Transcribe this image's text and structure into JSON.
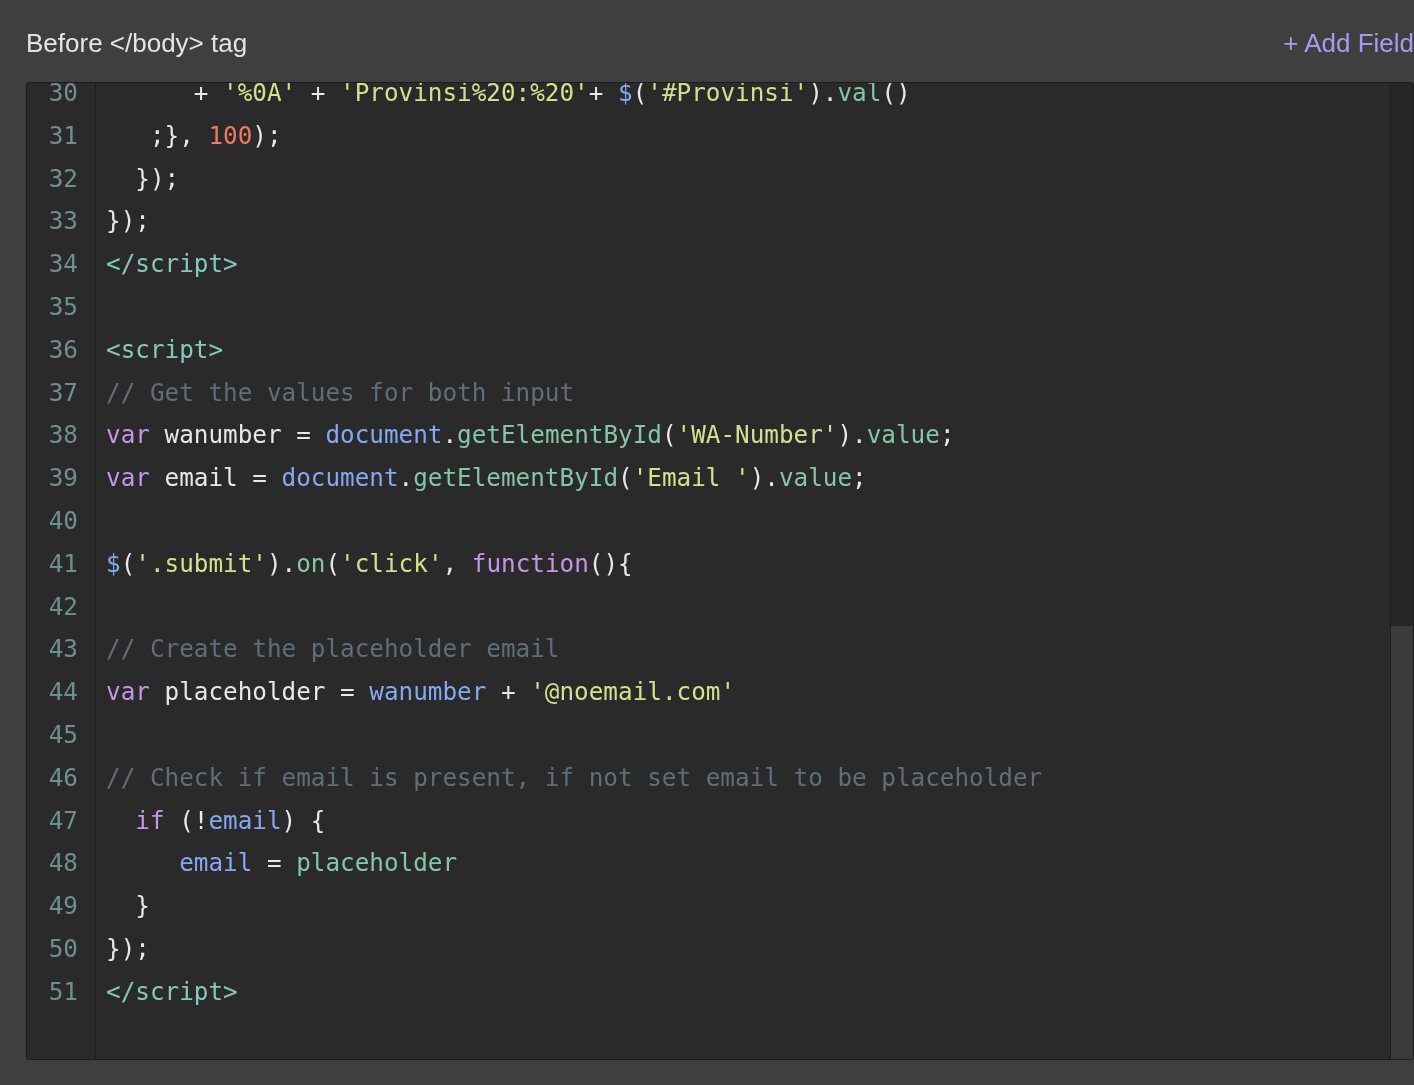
{
  "header": {
    "title": "Before </body> tag",
    "action": "+ Add Field"
  },
  "editor": {
    "lines": [
      {
        "number": "30",
        "tokens": [
          {
            "kind": "plain",
            "text": "      + "
          },
          {
            "kind": "string",
            "text": "'%0A'"
          },
          {
            "kind": "plain",
            "text": " + "
          },
          {
            "kind": "string",
            "text": "'Provinsi%20:%20'"
          },
          {
            "kind": "plain",
            "text": "+ "
          },
          {
            "kind": "variable",
            "text": "$"
          },
          {
            "kind": "plain",
            "text": "("
          },
          {
            "kind": "string",
            "text": "'#Provinsi'"
          },
          {
            "kind": "plain",
            "text": ")."
          },
          {
            "kind": "method",
            "text": "val"
          },
          {
            "kind": "plain",
            "text": "()"
          }
        ]
      },
      {
        "number": "31",
        "tokens": [
          {
            "kind": "plain",
            "text": "   ;}, "
          },
          {
            "kind": "number",
            "text": "100"
          },
          {
            "kind": "plain",
            "text": ");"
          }
        ]
      },
      {
        "number": "32",
        "tokens": [
          {
            "kind": "plain",
            "text": "  });"
          }
        ]
      },
      {
        "number": "33",
        "tokens": [
          {
            "kind": "plain",
            "text": "});"
          }
        ]
      },
      {
        "number": "34",
        "tokens": [
          {
            "kind": "tag",
            "text": "</script>"
          }
        ]
      },
      {
        "number": "35"
      },
      {
        "number": "36",
        "tokens": [
          {
            "kind": "tag",
            "text": "<script>"
          }
        ]
      },
      {
        "number": "37",
        "tokens": [
          {
            "kind": "comment",
            "text": "// Get the values for both input"
          }
        ]
      },
      {
        "number": "38",
        "tokens": [
          {
            "kind": "keyword",
            "text": "var"
          },
          {
            "kind": "plain",
            "text": " wanumber = "
          },
          {
            "kind": "variable",
            "text": "document"
          },
          {
            "kind": "plain",
            "text": "."
          },
          {
            "kind": "method",
            "text": "getElementById"
          },
          {
            "kind": "plain",
            "text": "("
          },
          {
            "kind": "string",
            "text": "'WA-Number'"
          },
          {
            "kind": "plain",
            "text": ")."
          },
          {
            "kind": "method",
            "text": "value"
          },
          {
            "kind": "plain",
            "text": ";"
          }
        ]
      },
      {
        "number": "39",
        "tokens": [
          {
            "kind": "keyword",
            "text": "var"
          },
          {
            "kind": "plain",
            "text": " email = "
          },
          {
            "kind": "variable",
            "text": "document"
          },
          {
            "kind": "plain",
            "text": "."
          },
          {
            "kind": "method",
            "text": "getElementById"
          },
          {
            "kind": "plain",
            "text": "("
          },
          {
            "kind": "string",
            "text": "'Email '"
          },
          {
            "kind": "plain",
            "text": ")."
          },
          {
            "kind": "method",
            "text": "value"
          },
          {
            "kind": "plain",
            "text": ";"
          }
        ]
      },
      {
        "number": "40"
      },
      {
        "number": "41",
        "tokens": [
          {
            "kind": "variable",
            "text": "$"
          },
          {
            "kind": "plain",
            "text": "("
          },
          {
            "kind": "string",
            "text": "'.submit'"
          },
          {
            "kind": "plain",
            "text": ")."
          },
          {
            "kind": "method",
            "text": "on"
          },
          {
            "kind": "plain",
            "text": "("
          },
          {
            "kind": "string",
            "text": "'click'"
          },
          {
            "kind": "plain",
            "text": ", "
          },
          {
            "kind": "keyword",
            "text": "function"
          },
          {
            "kind": "plain",
            "text": "(){"
          }
        ]
      },
      {
        "number": "42"
      },
      {
        "number": "43",
        "tokens": [
          {
            "kind": "comment",
            "text": "// Create the placeholder email"
          }
        ]
      },
      {
        "number": "44",
        "tokens": [
          {
            "kind": "keyword",
            "text": "var"
          },
          {
            "kind": "plain",
            "text": " placeholder = "
          },
          {
            "kind": "variable",
            "text": "wanumber"
          },
          {
            "kind": "plain",
            "text": " + "
          },
          {
            "kind": "string",
            "text": "'@noemail.com'"
          }
        ]
      },
      {
        "number": "45"
      },
      {
        "number": "46",
        "tokens": [
          {
            "kind": "comment",
            "text": "// Check if email is present, if not set email to be placeholder"
          }
        ]
      },
      {
        "number": "47",
        "tokens": [
          {
            "kind": "keyword",
            "text": "  if"
          },
          {
            "kind": "plain",
            "text": " (!"
          },
          {
            "kind": "variable",
            "text": "email"
          },
          {
            "kind": "plain",
            "text": ") {"
          }
        ]
      },
      {
        "number": "48",
        "tokens": [
          {
            "kind": "variable",
            "text": "     email"
          },
          {
            "kind": "plain",
            "text": " = "
          },
          {
            "kind": "method",
            "text": "placeholder"
          }
        ]
      },
      {
        "number": "49",
        "tokens": [
          {
            "kind": "plain",
            "text": "  }"
          }
        ]
      },
      {
        "number": "50",
        "tokens": [
          {
            "kind": "plain",
            "text": "});"
          }
        ]
      },
      {
        "number": "51",
        "tokens": [
          {
            "kind": "tag",
            "text": "</script>"
          }
        ]
      }
    ]
  }
}
